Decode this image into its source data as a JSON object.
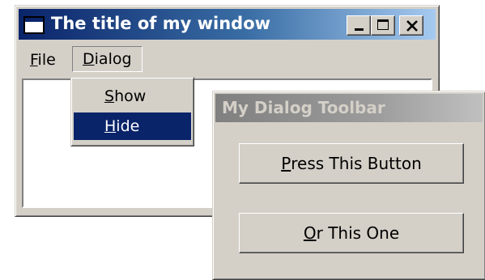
{
  "main_window": {
    "title": "The title of my window",
    "icons": {
      "app": "window-app-icon",
      "minimize": "minimize-icon",
      "maximize": "maximize-icon",
      "close": "close-icon"
    }
  },
  "menubar": {
    "file": {
      "mnemonic": "F",
      "rest": "ile"
    },
    "dialog": {
      "mnemonic": "D",
      "rest": "ialog"
    }
  },
  "dialog_menu": {
    "items": [
      {
        "mnemonic": "S",
        "rest": "how",
        "highlighted": false
      },
      {
        "mnemonic": "H",
        "rest": "ide",
        "highlighted": true
      }
    ]
  },
  "toolbar_dialog": {
    "title": "My Dialog Toolbar",
    "buttons": [
      {
        "mnemonic": "P",
        "rest": "ress This Button"
      },
      {
        "mnemonic": "O",
        "rest": "r This One"
      }
    ]
  },
  "colors": {
    "active_title_start": "#0a246a",
    "active_title_end": "#a6caf0",
    "inactive_title_start": "#808080",
    "inactive_title_end": "#c0c0c0",
    "face": "#d4d0c8",
    "menu_highlight": "#0a246a"
  }
}
